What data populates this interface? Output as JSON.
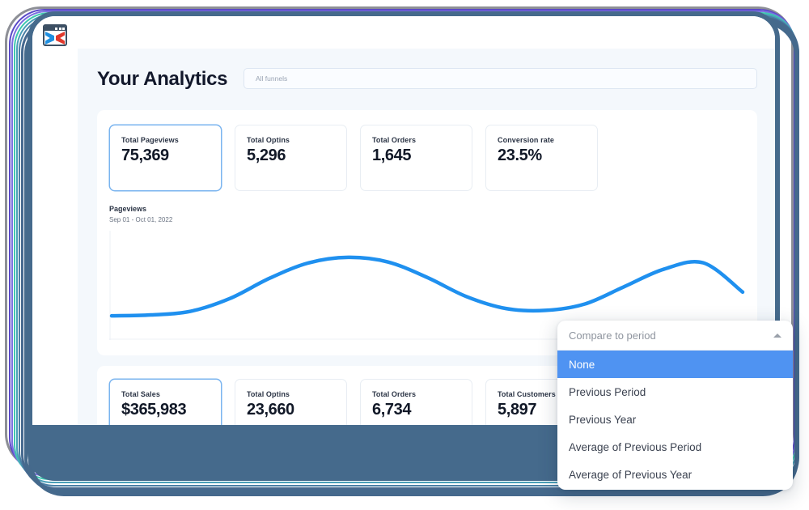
{
  "app": {
    "logo_icon": "funnel-browser-logo-icon"
  },
  "header": {
    "title": "Your Analytics",
    "funnel_filter_placeholder": "All funnels",
    "funnel_filter_value": ""
  },
  "kpis_primary": [
    {
      "label": "Total Pageviews",
      "value": "75,369",
      "selected": true
    },
    {
      "label": "Total Optins",
      "value": "5,296",
      "selected": false
    },
    {
      "label": "Total Orders",
      "value": "1,645",
      "selected": false
    },
    {
      "label": "Conversion rate",
      "value": "23.5%",
      "selected": false
    }
  ],
  "kpis_secondary": [
    {
      "label": "Total Sales",
      "value": "$365,983",
      "selected": true
    },
    {
      "label": "Total Optins",
      "value": "23,660",
      "selected": false
    },
    {
      "label": "Total Orders",
      "value": "6,734",
      "selected": false
    },
    {
      "label": "Total Customers",
      "value": "5,897",
      "selected": false
    }
  ],
  "chart_data": {
    "type": "line",
    "title": "Pageviews",
    "subtitle": "Sep 01 - Oct 01, 2022",
    "xlabel": "",
    "ylabel": "",
    "grid": false,
    "legend": "none",
    "line_color": "#1f90ef",
    "x": [
      0,
      1,
      2,
      3,
      4,
      5,
      6,
      7,
      8,
      9,
      10,
      11,
      12,
      13,
      14,
      15,
      16
    ],
    "series": [
      {
        "name": "Pageviews",
        "values": [
          14,
          15,
          19,
          33,
          55,
          72,
          78,
          73,
          56,
          35,
          22,
          20,
          27,
          46,
          65,
          72,
          40
        ]
      }
    ],
    "ylim": [
      0,
      100
    ]
  },
  "dropdown": {
    "header_label": "Compare to period",
    "caret_icon": "chevron-up-icon",
    "options": [
      {
        "label": "None",
        "selected": true
      },
      {
        "label": "Previous Period",
        "selected": false
      },
      {
        "label": "Previous Year",
        "selected": false
      },
      {
        "label": "Average of Previous Period",
        "selected": false
      },
      {
        "label": "Average of Previous Year",
        "selected": false
      }
    ]
  },
  "colors": {
    "accent": "#1f90ef",
    "dropdown_highlight": "#4f93f2",
    "device_frame": "#456a8c",
    "page_background": "#f4f8fc"
  }
}
